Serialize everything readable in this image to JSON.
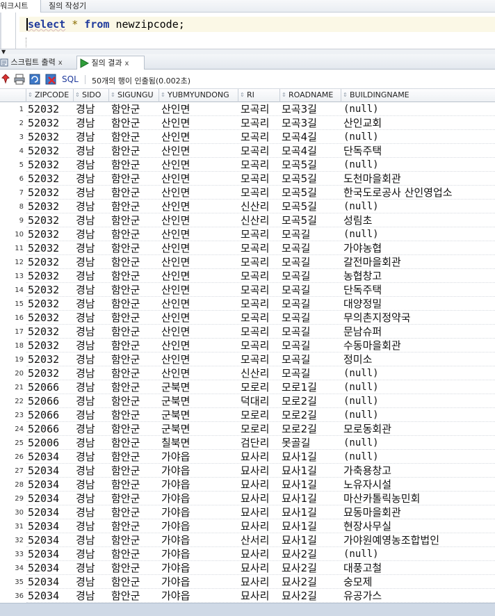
{
  "worksheet_tabs": [
    "워크시트",
    "질의 작성기"
  ],
  "editor": {
    "kw_select": "select",
    "star": "*",
    "kw_from": "from",
    "table": "newzipcode;"
  },
  "panel_tabs": [
    {
      "label": "스크립트 출력",
      "close": "x"
    },
    {
      "label": "질의 결과",
      "close": "x"
    }
  ],
  "toolbar": {
    "sql_label": "SQL",
    "status": "50개의 행이 인출됨(0.002초)"
  },
  "columns": [
    "ZIPCODE",
    "SIDO",
    "SIGUNGU",
    "YUBMYUNDONG",
    "RI",
    "ROADNAME",
    "BUILDINGNAME"
  ],
  "rows": [
    [
      "52032",
      "경남",
      "함안군",
      "산인면",
      "모곡리",
      "모곡3길",
      "(null)"
    ],
    [
      "52032",
      "경남",
      "함안군",
      "산인면",
      "모곡리",
      "모곡3길",
      "산인교회"
    ],
    [
      "52032",
      "경남",
      "함안군",
      "산인면",
      "모곡리",
      "모곡4길",
      "(null)"
    ],
    [
      "52032",
      "경남",
      "함안군",
      "산인면",
      "모곡리",
      "모곡4길",
      "단독주택"
    ],
    [
      "52032",
      "경남",
      "함안군",
      "산인면",
      "모곡리",
      "모곡5길",
      "(null)"
    ],
    [
      "52032",
      "경남",
      "함안군",
      "산인면",
      "모곡리",
      "모곡5길",
      "도천마을회관"
    ],
    [
      "52032",
      "경남",
      "함안군",
      "산인면",
      "모곡리",
      "모곡5길",
      "한국도로공사 산인영업소"
    ],
    [
      "52032",
      "경남",
      "함안군",
      "산인면",
      "신산리",
      "모곡5길",
      "(null)"
    ],
    [
      "52032",
      "경남",
      "함안군",
      "산인면",
      "신산리",
      "모곡5길",
      "성림초"
    ],
    [
      "52032",
      "경남",
      "함안군",
      "산인면",
      "모곡리",
      "모곡길",
      "(null)"
    ],
    [
      "52032",
      "경남",
      "함안군",
      "산인면",
      "모곡리",
      "모곡길",
      "가야농협"
    ],
    [
      "52032",
      "경남",
      "함안군",
      "산인면",
      "모곡리",
      "모곡길",
      "갈전마을회관"
    ],
    [
      "52032",
      "경남",
      "함안군",
      "산인면",
      "모곡리",
      "모곡길",
      "농협창고"
    ],
    [
      "52032",
      "경남",
      "함안군",
      "산인면",
      "모곡리",
      "모곡길",
      "단독주택"
    ],
    [
      "52032",
      "경남",
      "함안군",
      "산인면",
      "모곡리",
      "모곡길",
      "대양정밀"
    ],
    [
      "52032",
      "경남",
      "함안군",
      "산인면",
      "모곡리",
      "모곡길",
      "무의촌지정약국"
    ],
    [
      "52032",
      "경남",
      "함안군",
      "산인면",
      "모곡리",
      "모곡길",
      "문남슈퍼"
    ],
    [
      "52032",
      "경남",
      "함안군",
      "산인면",
      "모곡리",
      "모곡길",
      "수동마을회관"
    ],
    [
      "52032",
      "경남",
      "함안군",
      "산인면",
      "모곡리",
      "모곡길",
      "정미소"
    ],
    [
      "52032",
      "경남",
      "함안군",
      "산인면",
      "신산리",
      "모곡길",
      "(null)"
    ],
    [
      "52066",
      "경남",
      "함안군",
      "군북면",
      "모로리",
      "모로1길",
      "(null)"
    ],
    [
      "52066",
      "경남",
      "함안군",
      "군북면",
      "덕대리",
      "모로2길",
      "(null)"
    ],
    [
      "52066",
      "경남",
      "함안군",
      "군북면",
      "모로리",
      "모로2길",
      "(null)"
    ],
    [
      "52066",
      "경남",
      "함안군",
      "군북면",
      "모로리",
      "모로2길",
      "모로동회관"
    ],
    [
      "52006",
      "경남",
      "함안군",
      "칠북면",
      "검단리",
      "못골길",
      "(null)"
    ],
    [
      "52034",
      "경남",
      "함안군",
      "가야읍",
      "묘사리",
      "묘사1길",
      "(null)"
    ],
    [
      "52034",
      "경남",
      "함안군",
      "가야읍",
      "묘사리",
      "묘사1길",
      "가축용창고"
    ],
    [
      "52034",
      "경남",
      "함안군",
      "가야읍",
      "묘사리",
      "묘사1길",
      "노유자시설"
    ],
    [
      "52034",
      "경남",
      "함안군",
      "가야읍",
      "묘사리",
      "묘사1길",
      "마산카톨릭농민회"
    ],
    [
      "52034",
      "경남",
      "함안군",
      "가야읍",
      "묘사리",
      "묘사1길",
      "묘동마을회관"
    ],
    [
      "52034",
      "경남",
      "함안군",
      "가야읍",
      "묘사리",
      "묘사1길",
      "현장사무실"
    ],
    [
      "52034",
      "경남",
      "함안군",
      "가야읍",
      "산서리",
      "묘사1길",
      "가야원예영농조합법인"
    ],
    [
      "52034",
      "경남",
      "함안군",
      "가야읍",
      "묘사리",
      "묘사2길",
      "(null)"
    ],
    [
      "52034",
      "경남",
      "함안군",
      "가야읍",
      "묘사리",
      "묘사2길",
      "대풍고철"
    ],
    [
      "52034",
      "경남",
      "함안군",
      "가야읍",
      "묘사리",
      "묘사2길",
      "숭모제"
    ],
    [
      "52034",
      "경남",
      "함안군",
      "가야읍",
      "묘사리",
      "묘사2길",
      "유공가스"
    ]
  ]
}
